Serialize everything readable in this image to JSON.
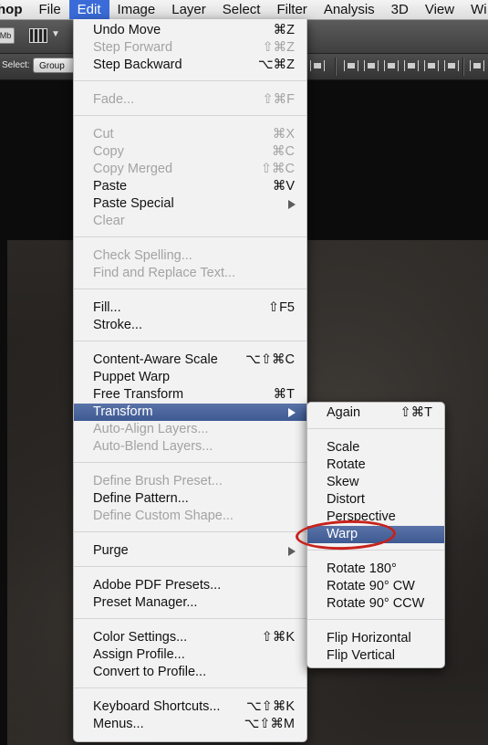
{
  "menubar": {
    "app_fragment": "hop",
    "items": [
      "File",
      "Edit",
      "Image",
      "Layer",
      "Select",
      "Filter",
      "Analysis",
      "3D",
      "View",
      "Wi"
    ]
  },
  "appbar": {
    "badge": "Mb"
  },
  "options": {
    "select_label": "Select:",
    "select_value": "Group"
  },
  "edit_menu": {
    "undo_move": {
      "label": "Undo Move",
      "shortcut": "⌘Z"
    },
    "step_forward": {
      "label": "Step Forward",
      "shortcut": "⇧⌘Z"
    },
    "step_backward": {
      "label": "Step Backward",
      "shortcut": "⌥⌘Z"
    },
    "fade": {
      "label": "Fade...",
      "shortcut": "⇧⌘F"
    },
    "cut": {
      "label": "Cut",
      "shortcut": "⌘X"
    },
    "copy": {
      "label": "Copy",
      "shortcut": "⌘C"
    },
    "copy_merged": {
      "label": "Copy Merged",
      "shortcut": "⇧⌘C"
    },
    "paste": {
      "label": "Paste",
      "shortcut": "⌘V"
    },
    "paste_special": {
      "label": "Paste Special"
    },
    "clear": {
      "label": "Clear"
    },
    "check_spelling": {
      "label": "Check Spelling..."
    },
    "find_replace": {
      "label": "Find and Replace Text..."
    },
    "fill": {
      "label": "Fill...",
      "shortcut": "⇧F5"
    },
    "stroke": {
      "label": "Stroke..."
    },
    "content_aware": {
      "label": "Content-Aware Scale",
      "shortcut": "⌥⇧⌘C"
    },
    "puppet_warp": {
      "label": "Puppet Warp"
    },
    "free_transform": {
      "label": "Free Transform",
      "shortcut": "⌘T"
    },
    "transform": {
      "label": "Transform"
    },
    "auto_align": {
      "label": "Auto-Align Layers..."
    },
    "auto_blend": {
      "label": "Auto-Blend Layers..."
    },
    "define_brush": {
      "label": "Define Brush Preset..."
    },
    "define_pattern": {
      "label": "Define Pattern..."
    },
    "define_shape": {
      "label": "Define Custom Shape..."
    },
    "purge": {
      "label": "Purge"
    },
    "pdf_presets": {
      "label": "Adobe PDF Presets..."
    },
    "preset_manager": {
      "label": "Preset Manager..."
    },
    "color_settings": {
      "label": "Color Settings...",
      "shortcut": "⇧⌘K"
    },
    "assign_profile": {
      "label": "Assign Profile..."
    },
    "convert_profile": {
      "label": "Convert to Profile..."
    },
    "keyboard_shortcuts": {
      "label": "Keyboard Shortcuts...",
      "shortcut": "⌥⇧⌘K"
    },
    "menus": {
      "label": "Menus...",
      "shortcut": "⌥⇧⌘M"
    }
  },
  "transform_menu": {
    "again": {
      "label": "Again",
      "shortcut": "⇧⌘T"
    },
    "scale": {
      "label": "Scale"
    },
    "rotate": {
      "label": "Rotate"
    },
    "skew": {
      "label": "Skew"
    },
    "distort": {
      "label": "Distort"
    },
    "perspective": {
      "label": "Perspective"
    },
    "warp": {
      "label": "Warp"
    },
    "rotate_180": {
      "label": "Rotate 180°"
    },
    "rotate_90cw": {
      "label": "Rotate 90° CW"
    },
    "rotate_90ccw": {
      "label": "Rotate 90° CCW"
    },
    "flip_h": {
      "label": "Flip Horizontal"
    },
    "flip_v": {
      "label": "Flip Vertical"
    }
  },
  "colors": {
    "highlight": "#3e5a92",
    "annotation": "#c8221c",
    "menubar_active": "#3a6bd8"
  }
}
